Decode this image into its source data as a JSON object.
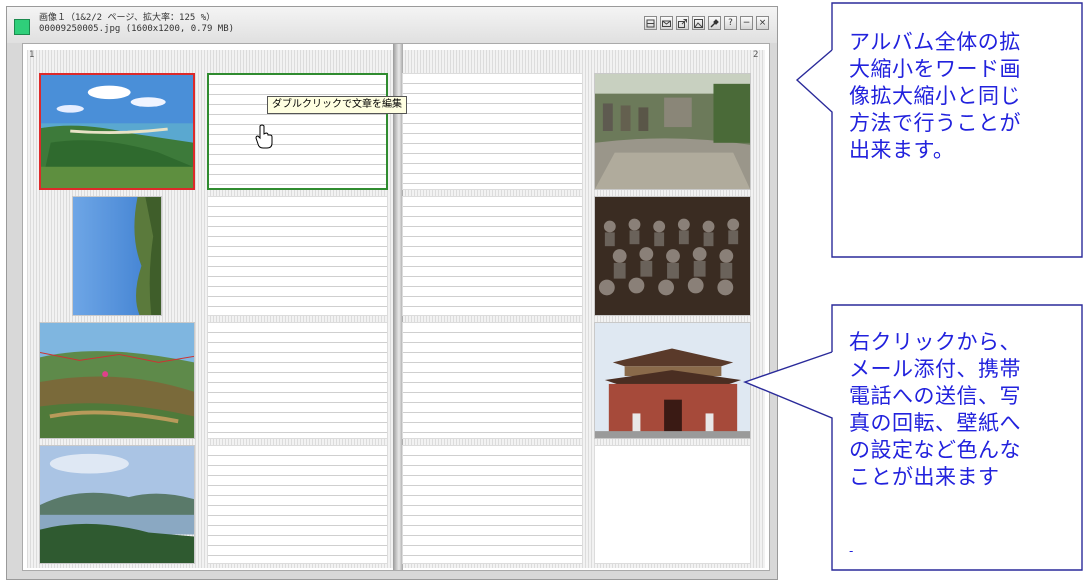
{
  "window": {
    "title_line1": "画像１（1&2/2 ページ、拡大率：125 %）",
    "title_line2": "00009250005.jpg (1600x1200, 0.79 MB)",
    "buttons": [
      {
        "icon": "view-icon",
        "label": ""
      },
      {
        "icon": "mail-icon",
        "label": ""
      },
      {
        "icon": "export-icon",
        "label": ""
      },
      {
        "icon": "image-icon",
        "label": ""
      },
      {
        "icon": "pin-icon",
        "label": ""
      },
      {
        "icon": "help-icon",
        "label": "?"
      },
      {
        "icon": "minimize-icon",
        "label": "−"
      },
      {
        "icon": "close-icon",
        "label": "×"
      }
    ]
  },
  "album": {
    "left_page_number": "1",
    "right_page_number": "2",
    "tooltip": "ダブルクリックで文章を編集",
    "photos": [
      {
        "name": "photo-coast-aerial",
        "selected": true
      },
      {
        "name": "photo-sky-rotated",
        "selected": false
      },
      {
        "name": "photo-hillside-flags",
        "selected": false
      },
      {
        "name": "photo-bay-landscape",
        "selected": false
      },
      {
        "name": "photo-stone-ruins",
        "selected": false
      },
      {
        "name": "photo-statues",
        "selected": false
      },
      {
        "name": "photo-chinese-gate",
        "selected": false
      }
    ]
  },
  "callouts": {
    "top": "アルバム全体の拡\n大縮小をワード画\n像拡大縮小と同じ\n方法で行うことが\n出来ます。",
    "bottom": "右クリックから、\nメール添付、携帯\n電話への送信、写\n真の回転、壁紙へ\nの設定など色んな\nことが出来ます",
    "bottom_mark": "-",
    "color": "#2222dd"
  }
}
